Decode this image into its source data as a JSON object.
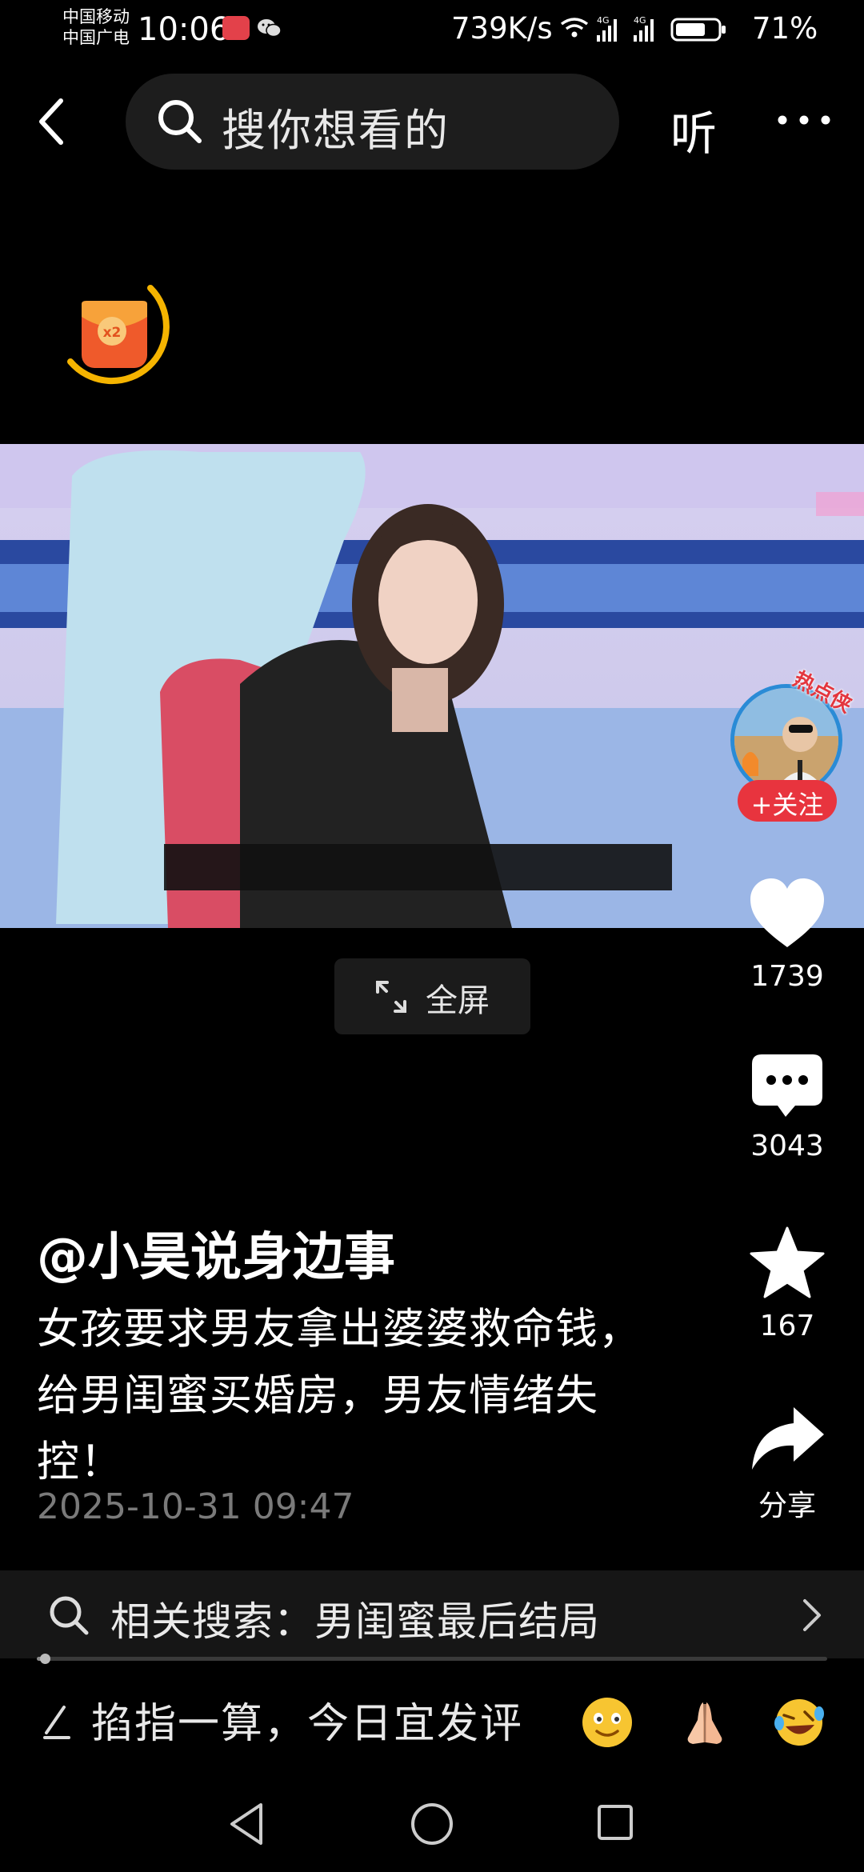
{
  "status_bar": {
    "carrier1": "中国移动",
    "carrier2": "中国广电",
    "time": "10:06",
    "net_speed": "739K/s",
    "battery": "71%"
  },
  "top_nav": {
    "search_placeholder": "搜你想看的",
    "listen_label": "听"
  },
  "author": {
    "hot_tag": "热点侠",
    "follow_label": "+关注",
    "name": "@小昊说身边事"
  },
  "actions": {
    "like_count": "1739",
    "comment_count": "3043",
    "star_count": "167",
    "share_label": "分享"
  },
  "video": {
    "fullscreen_label": "全屏",
    "progress": 0.01
  },
  "post": {
    "description": "女孩要求男友拿出婆婆救命钱，给男闺蜜买婚房，男友情绪失控！",
    "time": "2025-10-31 09:47"
  },
  "related_search": {
    "text": "相关搜索：男闺蜜最后结局"
  },
  "comment_bar": {
    "placeholder": "掐指一算，今日宜发评"
  },
  "colors": {
    "accent_red": "#e8343e",
    "background": "#000000",
    "reward_ring": "#f5b400"
  },
  "icons": {
    "back": "chevron-left-icon",
    "search": "search-icon",
    "more": "more-dots-icon",
    "like": "heart-icon",
    "comment": "comment-bubble-icon",
    "star": "star-icon",
    "share": "share-arrow-icon"
  }
}
